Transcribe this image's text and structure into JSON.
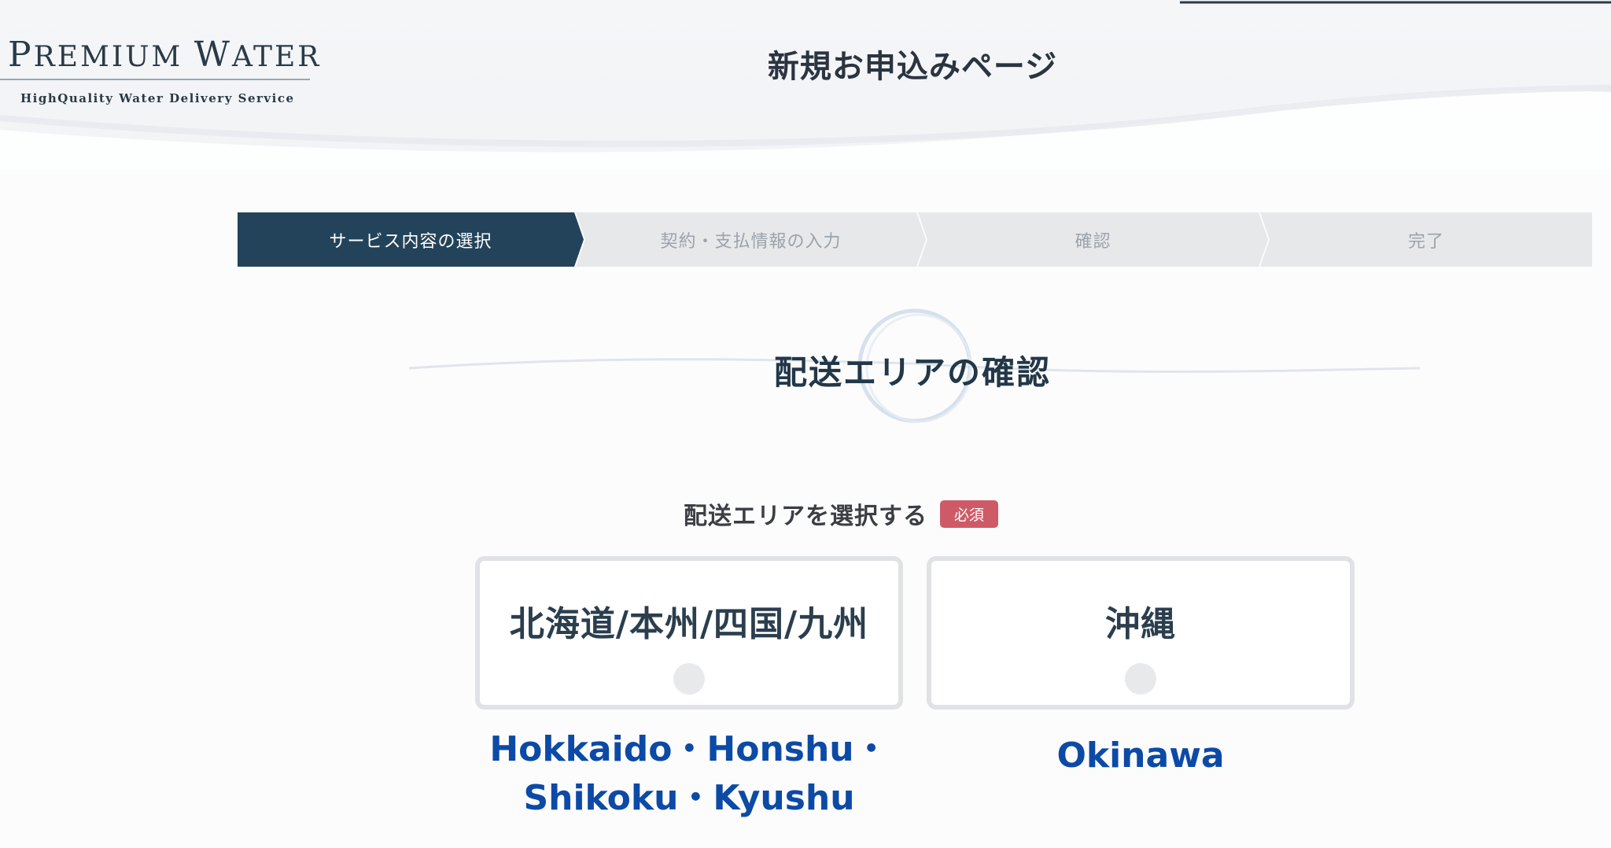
{
  "brand": {
    "name": "Premium Water",
    "tagline": "HighQuality  Water  Delivery  Service"
  },
  "page_title": "新規お申込みページ",
  "steps": [
    {
      "label": "サービス内容の選択",
      "active": true
    },
    {
      "label": "契約・支払情報の入力",
      "active": false
    },
    {
      "label": "確認",
      "active": false
    },
    {
      "label": "完了",
      "active": false
    }
  ],
  "section_title": "配送エリアの確認",
  "select": {
    "label": "配送エリアを選択する",
    "required_badge": "必須"
  },
  "options": [
    {
      "label": "北海道/本州/四国/九州",
      "caption_line1": "Hokkaido・Honshu・",
      "caption_line2": "Shikoku・Kyushu"
    },
    {
      "label": "沖縄",
      "caption_line1": "Okinawa"
    }
  ],
  "colors": {
    "accent": "#23435a",
    "inactive_step": "#e7e8ea",
    "required_badge": "#cf5a67",
    "caption": "#0c4aa6"
  }
}
